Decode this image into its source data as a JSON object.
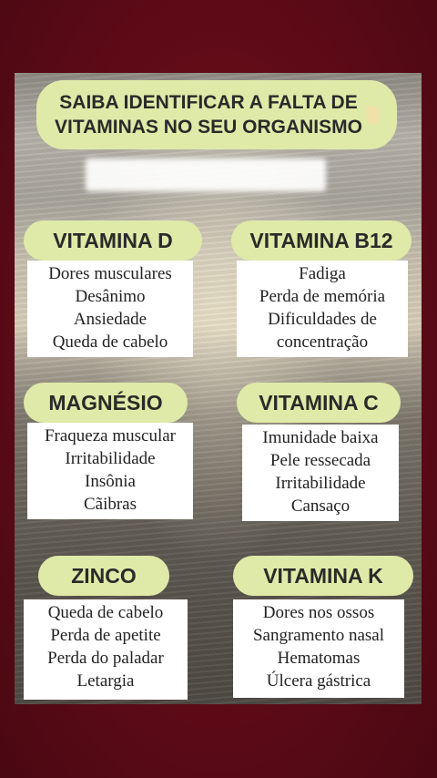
{
  "title": "SAIBA IDENTIFICAR A FALTA DE\nVITAMINAS NO SEU ORGANISMO",
  "sections": [
    {
      "heading": "VITAMINA D",
      "items": [
        "Dores musculares",
        "Desânimo",
        "Ansiedade",
        "Queda de cabelo"
      ]
    },
    {
      "heading": "VITAMINA B12",
      "items": [
        "Fadiga",
        "Perda de memória",
        "Dificuldades de",
        "concentração"
      ]
    },
    {
      "heading": "MAGNÉSIO",
      "items": [
        "Fraqueza muscular",
        "Irritabilidade",
        "Insônia",
        "Cãibras"
      ]
    },
    {
      "heading": "VITAMINA C",
      "items": [
        "Imunidade baixa",
        "Pele ressecada",
        "Irritabilidade",
        "Cansaço"
      ]
    },
    {
      "heading": "ZINCO",
      "items": [
        "Queda de cabelo",
        "Perda de apetite",
        "Perda do paladar",
        "Letargia"
      ]
    },
    {
      "heading": "VITAMINA K",
      "items": [
        "Dores nos ossos",
        "Sangramento nasal",
        "Hematomas",
        "Úlcera gástrica"
      ]
    }
  ],
  "colors": {
    "pill": "#dfeaa8",
    "frame": "#6a0d19"
  },
  "icons": {
    "title_emoji": "hand-icon"
  }
}
